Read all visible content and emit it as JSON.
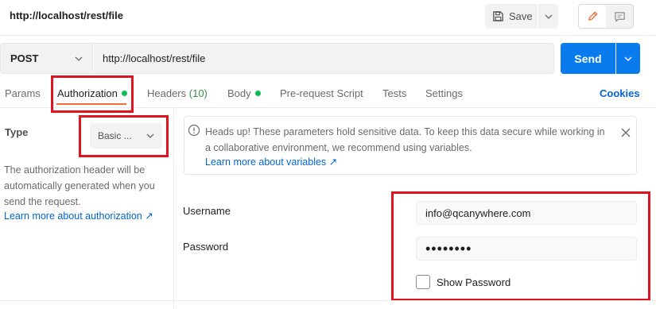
{
  "header": {
    "title": "http://localhost/rest/file",
    "save_label": "Save",
    "save_icon": "floppy-disk-icon",
    "edit_icon": "pencil-icon",
    "comment_icon": "comment-icon"
  },
  "request": {
    "method": "POST",
    "url": "http://localhost/rest/file",
    "send_label": "Send"
  },
  "tabs": [
    {
      "label": "Params"
    },
    {
      "label": "Authorization",
      "dot": true
    },
    {
      "label": "Headers",
      "count": "(10)"
    },
    {
      "label": "Body",
      "dot": true
    },
    {
      "label": "Pre-request Script"
    },
    {
      "label": "Tests"
    },
    {
      "label": "Settings"
    }
  ],
  "cookies_label": "Cookies",
  "auth": {
    "type_label": "Type",
    "type_value": "Basic ...",
    "description": "The authorization header will be automatically generated when you send the request.",
    "learn_more": "Learn more about authorization ↗"
  },
  "banner": {
    "text": "Heads up! These parameters hold sensitive data. To keep this data secure while working in a collaborative environment, we recommend using variables.",
    "link": "Learn more about variables ↗"
  },
  "fields": {
    "username_label": "Username",
    "username_value": "info@qcanywhere.com",
    "password_label": "Password",
    "password_value": "••••••••",
    "show_password_label": "Show Password"
  },
  "colors": {
    "accent": "#097bed",
    "highlight_box": "#e0141e",
    "active_tab_underline": "#f26b3a",
    "status_dot": "#0cbb52",
    "link": "#0265d2"
  }
}
